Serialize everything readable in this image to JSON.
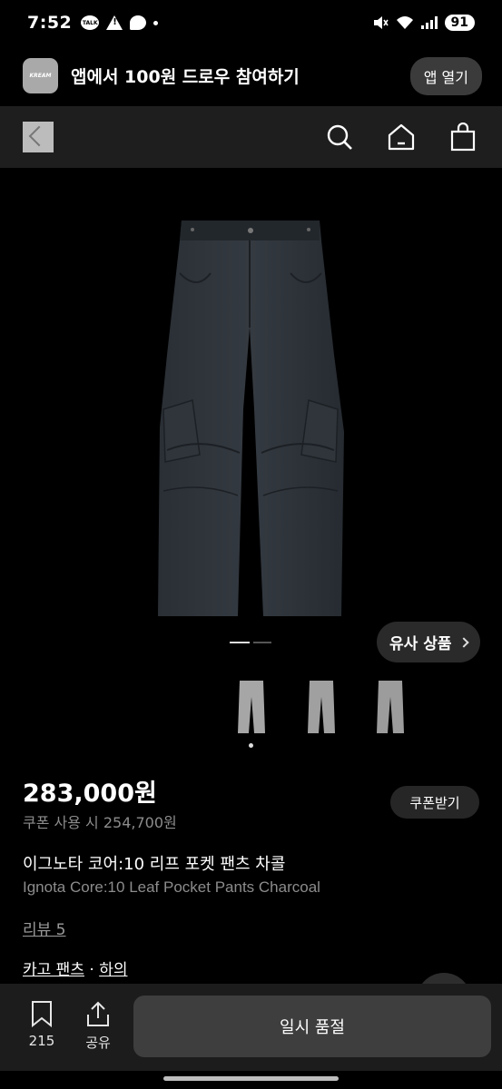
{
  "status": {
    "time": "7:52",
    "talk_badge": "TALK",
    "battery": "91"
  },
  "banner": {
    "logo_text": "KREAM",
    "text": "앱에서 100원 드로우 참여하기",
    "open_button": "앱 열기"
  },
  "gallery": {
    "similar_button": "유사 상품"
  },
  "product": {
    "price": "283,000원",
    "coupon_price": "쿠폰 사용 시 254,700원",
    "coupon_button": "쿠폰받기",
    "name_ko": "이그노타 코어:10 리프 포켓 팬츠 차콜",
    "name_en": "Ignota Core:10 Leaf Pocket Pants Charcoal",
    "review": "리뷰 5",
    "category_1": "카고 팬츠",
    "category_sep": " · ",
    "category_2": "하의"
  },
  "bottom": {
    "bookmark_count": "215",
    "share_label": "공유",
    "action_button": "일시 품절"
  },
  "colors": {
    "background": "#000000",
    "nav": "#1e1e1e",
    "pants": "#2b3036",
    "muted_text": "#8c8c8c"
  }
}
